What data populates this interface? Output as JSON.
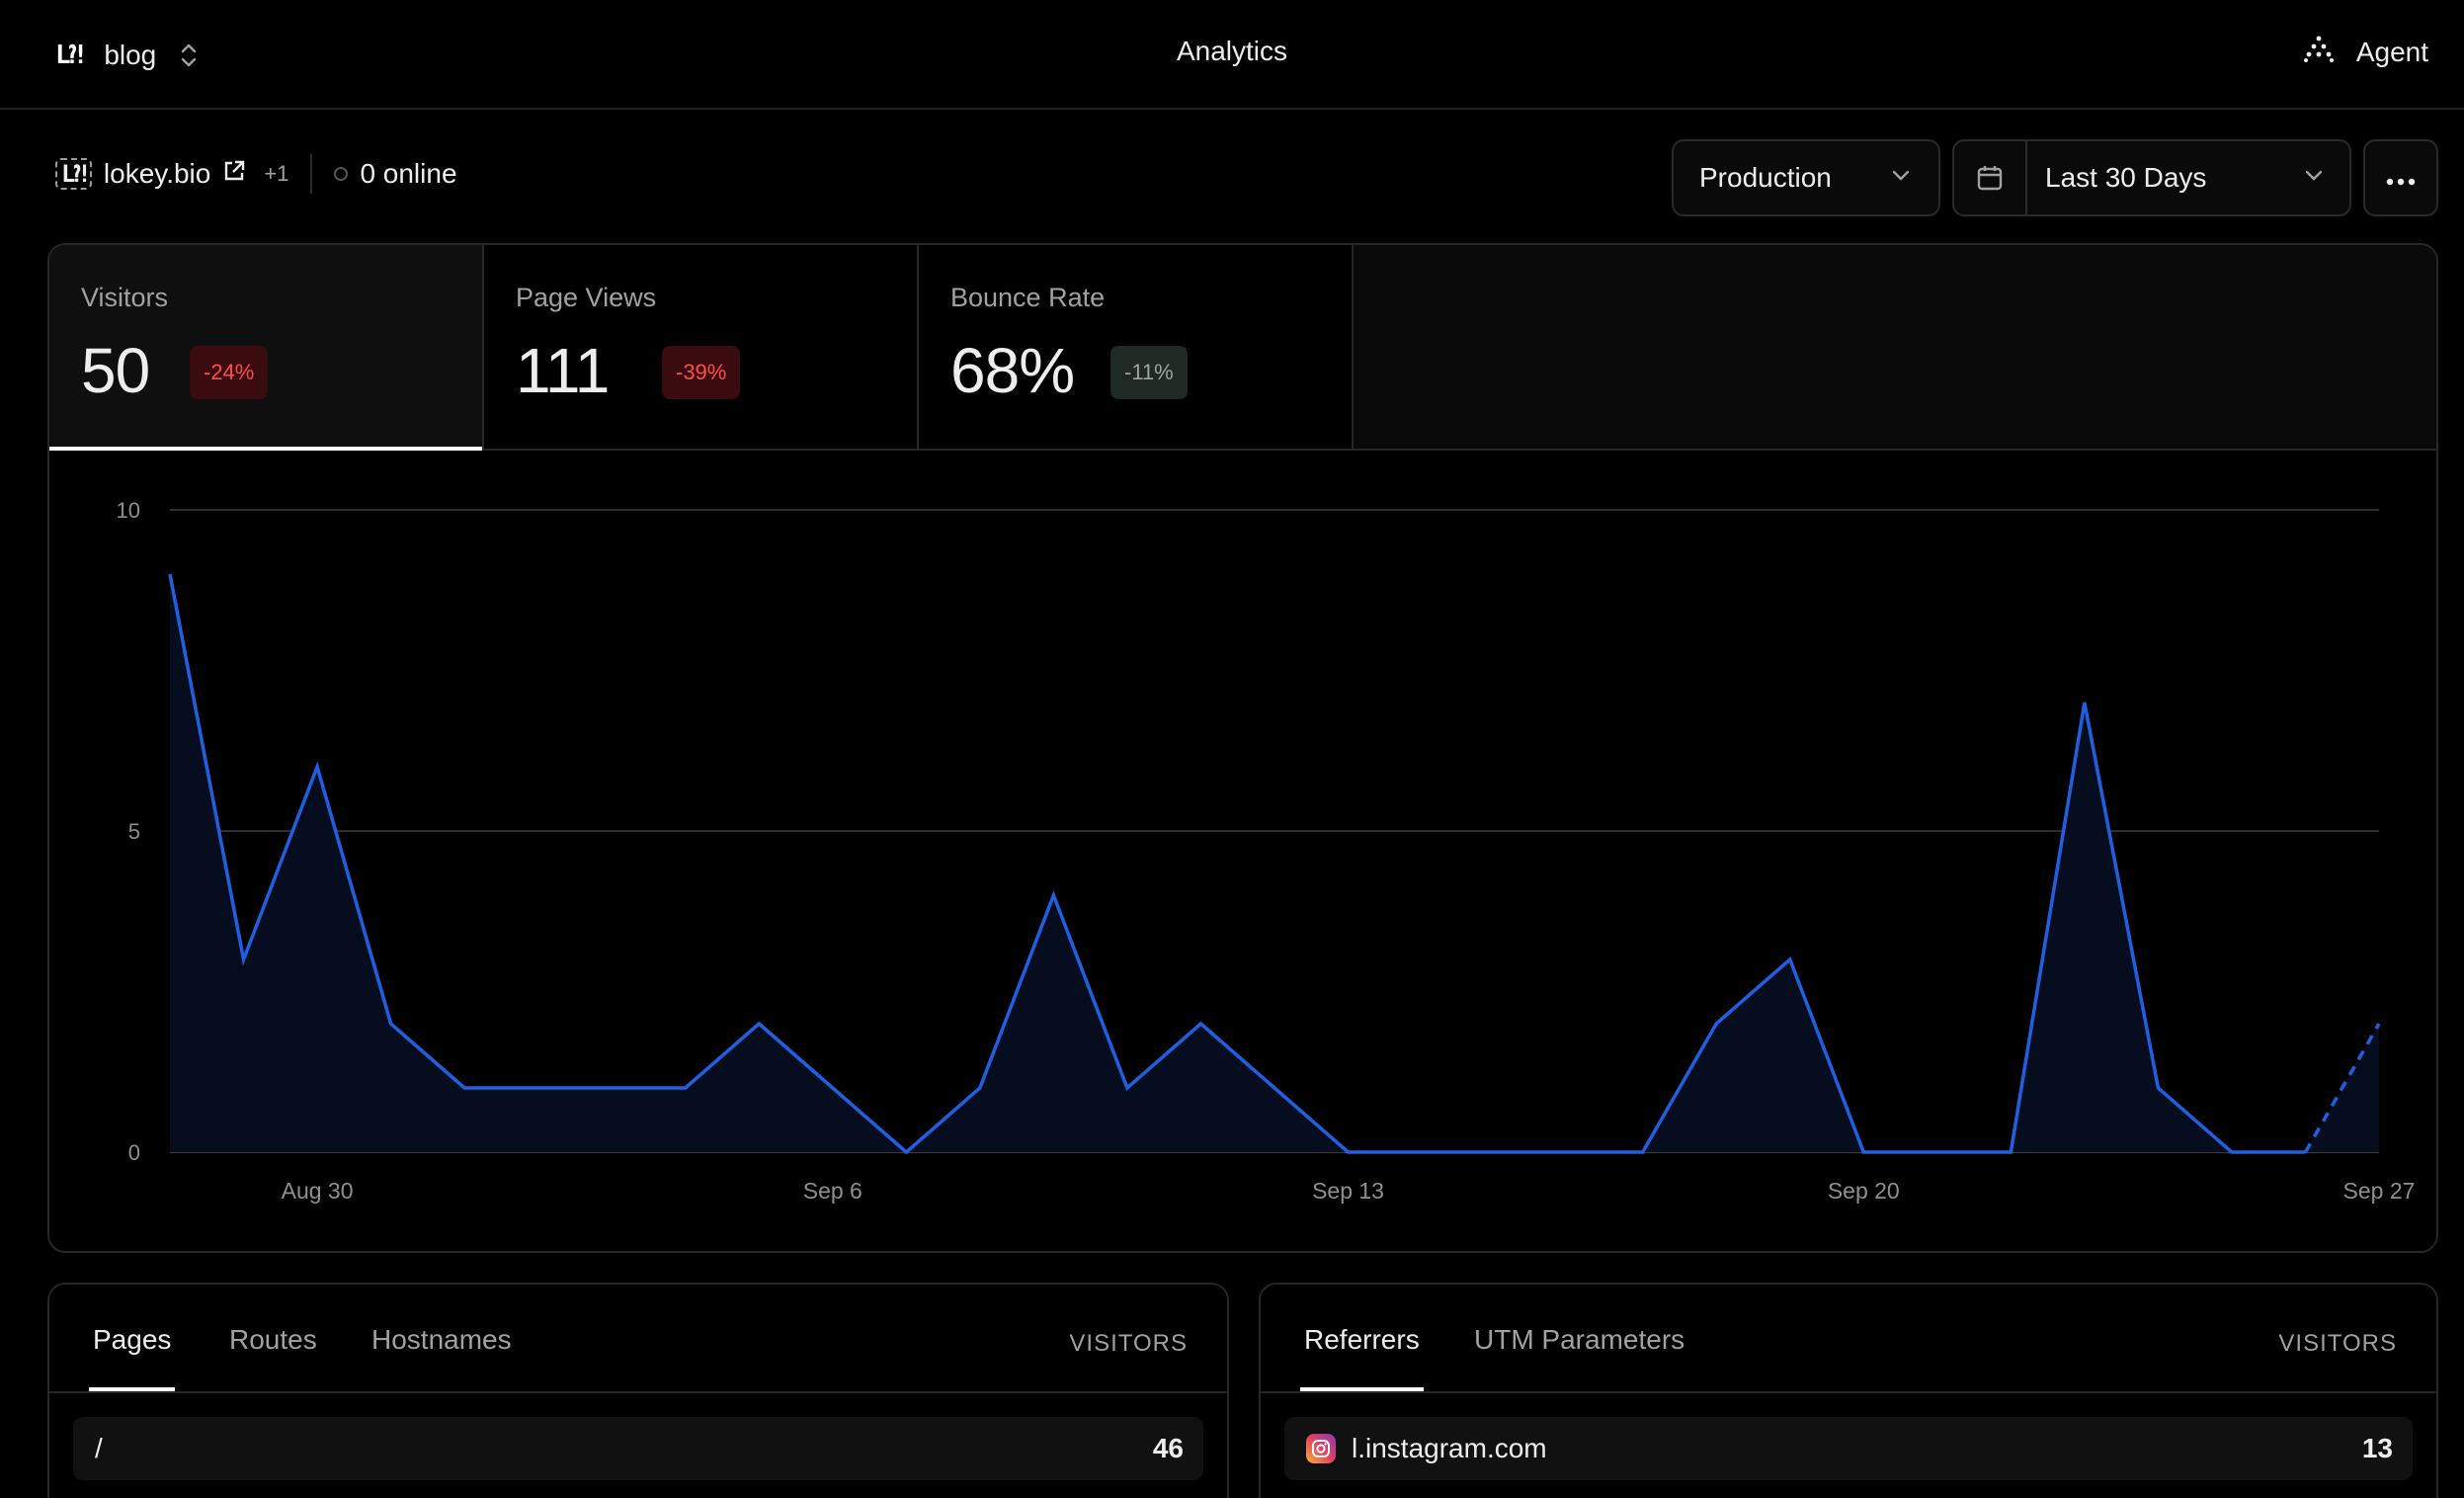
{
  "topbar": {
    "project_logo": "L⁈",
    "project_name": "blog",
    "title": "Analytics",
    "agent_label": "Agent"
  },
  "subheader": {
    "site_logo": "L⁈",
    "site_name": "lokey.bio",
    "extra_domains": "+1",
    "online": "0 online"
  },
  "controls": {
    "environment": "Production",
    "range": "Last 30 Days"
  },
  "metrics": [
    {
      "label": "Visitors",
      "value": "50",
      "change": "-24%",
      "tone": "neg"
    },
    {
      "label": "Page Views",
      "value": "111",
      "change": "-39%",
      "tone": "neg"
    },
    {
      "label": "Bounce Rate",
      "value": "68%",
      "change": "-11%",
      "tone": "neutral"
    }
  ],
  "chart_data": {
    "type": "area",
    "x_tick_labels": [
      "Aug 30",
      "Sep 6",
      "Sep 13",
      "Sep 20",
      "Sep 27"
    ],
    "y_tick_labels": [
      "10",
      "5",
      "0"
    ],
    "ylim": [
      0,
      10
    ],
    "grid": true,
    "days": [
      "Aug 28",
      "Aug 29",
      "Aug 30",
      "Aug 31",
      "Sep 1",
      "Sep 2",
      "Sep 3",
      "Sep 4",
      "Sep 5",
      "Sep 6",
      "Sep 7",
      "Sep 8",
      "Sep 9",
      "Sep 10",
      "Sep 11",
      "Sep 12",
      "Sep 13",
      "Sep 14",
      "Sep 15",
      "Sep 16",
      "Sep 17",
      "Sep 18",
      "Sep 19",
      "Sep 20",
      "Sep 21",
      "Sep 22",
      "Sep 23",
      "Sep 24",
      "Sep 25",
      "Sep 26",
      "Sep 27"
    ],
    "series": [
      {
        "values": [
          9,
          3,
          6,
          2,
          1,
          1,
          1,
          1,
          2,
          1,
          0,
          1,
          4,
          1,
          2,
          1,
          0,
          0,
          0,
          0,
          0,
          2,
          3,
          0,
          0,
          0,
          7,
          1,
          0,
          0,
          2
        ]
      }
    ],
    "dashed_last_segment": true,
    "line_color": "#1f5fe0",
    "fill_color": "#050d1f"
  },
  "pages_panel": {
    "tabs": [
      "Pages",
      "Routes",
      "Hostnames"
    ],
    "column": "VISITORS",
    "rows": [
      {
        "label": "/",
        "count": "46"
      }
    ]
  },
  "referrers_panel": {
    "tabs": [
      "Referrers",
      "UTM Parameters"
    ],
    "column": "VISITORS",
    "rows": [
      {
        "label": "l.instagram.com",
        "count": "13",
        "icon": "instagram-icon"
      }
    ]
  }
}
